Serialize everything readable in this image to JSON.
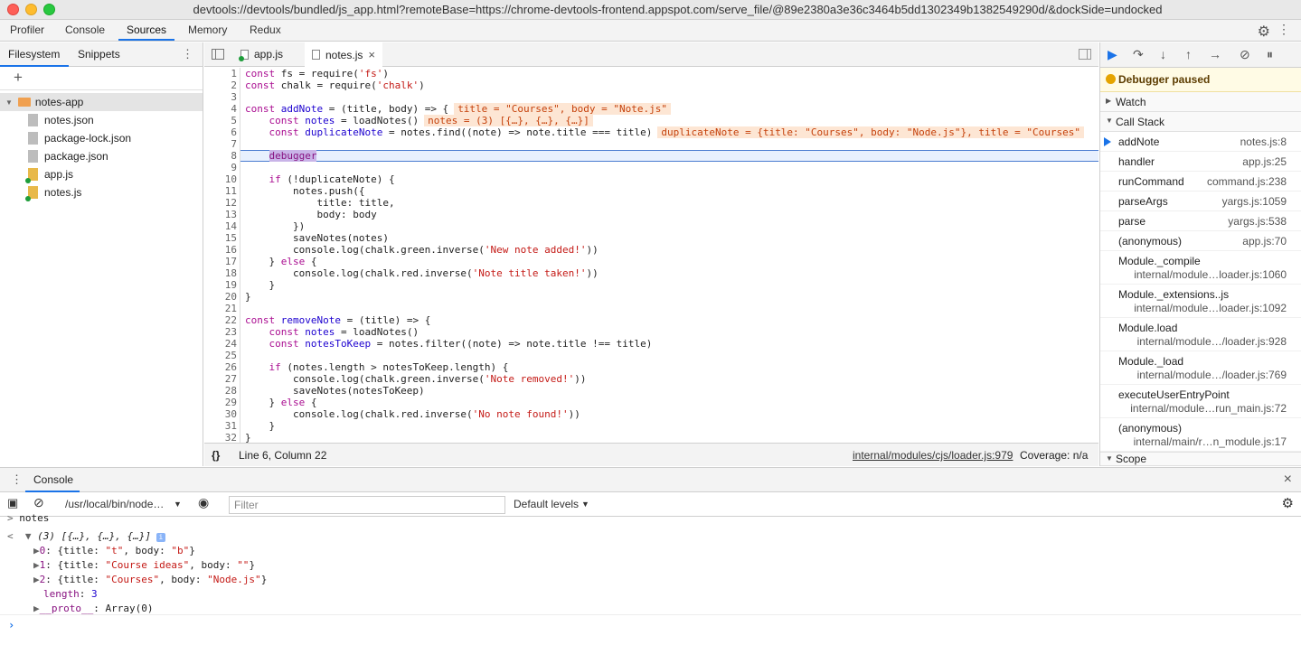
{
  "window": {
    "title": "devtools://devtools/bundled/js_app.html?remoteBase=https://chrome-devtools-frontend.appspot.com/serve_file/@89e2380a3e36c3464b5dd1302349b1382549290d/&dockSide=undocked"
  },
  "main_tabs": [
    "Profiler",
    "Console",
    "Sources",
    "Memory",
    "Redux"
  ],
  "main_tabs_active": "Sources",
  "navigator": {
    "tabs": [
      "Filesystem",
      "Snippets"
    ],
    "root": "notes-app",
    "files": [
      "notes.json",
      "package-lock.json",
      "package.json",
      "app.js",
      "notes.js"
    ]
  },
  "editor": {
    "tabs": [
      "app.js",
      "notes.js"
    ],
    "active_tab": "notes.js",
    "status_position": "Line 6, Column 22",
    "status_source": "internal/modules/cjs/loader.js:979",
    "status_coverage": "Coverage: n/a",
    "inline_values": {
      "line4": "title = \"Courses\", body = \"Note.js\"",
      "line5": "notes = (3) [{…}, {…}, {…}]",
      "line6": "duplicateNote = {title: \"Courses\", body: \"Node.js\"}, title = \"Courses\""
    },
    "line_numbers": [
      "1",
      "2",
      "3",
      "4",
      "5",
      "6",
      "7",
      "8",
      "9",
      "10",
      "11",
      "12",
      "13",
      "14",
      "15",
      "16",
      "17",
      "18",
      "19",
      "20",
      "21",
      "22",
      "23",
      "24",
      "25",
      "26",
      "27",
      "28",
      "29",
      "30",
      "31",
      "32"
    ]
  },
  "debugger": {
    "paused_label": "Debugger paused",
    "watch_label": "Watch",
    "callstack_label": "Call Stack",
    "scope_label": "Scope",
    "frames": [
      {
        "name": "addNote",
        "loc": "notes.js:8",
        "loc2": ""
      },
      {
        "name": "handler",
        "loc": "app.js:25",
        "loc2": ""
      },
      {
        "name": "runCommand",
        "loc": "command.js:238",
        "loc2": ""
      },
      {
        "name": "parseArgs",
        "loc": "yargs.js:1059",
        "loc2": ""
      },
      {
        "name": "parse",
        "loc": "yargs.js:538",
        "loc2": ""
      },
      {
        "name": "(anonymous)",
        "loc": "app.js:70",
        "loc2": ""
      },
      {
        "name": "Module._compile",
        "loc": "",
        "loc2": "internal/module…loader.js:1060"
      },
      {
        "name": "Module._extensions..js",
        "loc": "",
        "loc2": "internal/module…loader.js:1092"
      },
      {
        "name": "Module.load",
        "loc": "",
        "loc2": "internal/module…/loader.js:928"
      },
      {
        "name": "Module._load",
        "loc": "",
        "loc2": "internal/module…/loader.js:769"
      },
      {
        "name": "executeUserEntryPoint",
        "loc": "",
        "loc2": "internal/module…run_main.js:72"
      },
      {
        "name": "(anonymous)",
        "loc": "",
        "loc2": "internal/main/r…n_module.js:17"
      }
    ]
  },
  "console": {
    "tab_label": "Console",
    "context": "/usr/local/bin/node…",
    "filter_placeholder": "Filter",
    "levels": "Default levels",
    "input_echo": "notes",
    "result_summary": "(3) [{…}, {…}, {…}]",
    "entries": [
      {
        "idx": "0",
        "title": "\"t\"",
        "body": "\"b\""
      },
      {
        "idx": "1",
        "title": "\"Course ideas\"",
        "body": "\"\""
      },
      {
        "idx": "2",
        "title": "\"Courses\"",
        "body": "\"Node.js\""
      }
    ],
    "length_label": "length",
    "length_value": "3",
    "proto_label": "__proto__",
    "proto_value": "Array(0)"
  }
}
